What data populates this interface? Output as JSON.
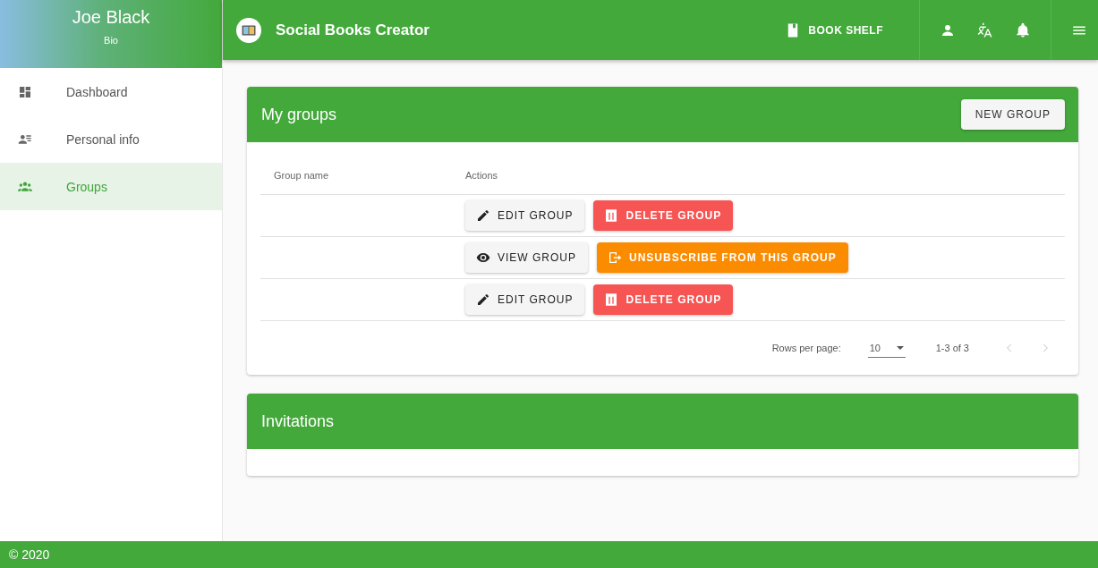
{
  "user": {
    "name": "Joe Black",
    "subtitle": "Bio"
  },
  "sidebar": {
    "items": [
      {
        "label": "Dashboard",
        "kind": "dashboard",
        "selected": false
      },
      {
        "label": "Personal info",
        "kind": "person",
        "selected": false
      },
      {
        "label": "Groups",
        "kind": "groups",
        "selected": true
      }
    ]
  },
  "app_bar": {
    "title": "Social Books Creator",
    "bookshelf": "BOOK SHELF"
  },
  "my_groups": {
    "title": "My groups",
    "new_button": "NEW GROUP",
    "columns": [
      "Group name",
      "Actions"
    ],
    "rows": [
      {
        "actions": [
          {
            "kind": "edit",
            "label": "EDIT GROUP"
          },
          {
            "kind": "delete",
            "label": "DELETE GROUP"
          }
        ]
      },
      {
        "actions": [
          {
            "kind": "view",
            "label": "VIEW GROUP"
          },
          {
            "kind": "unsubscribe",
            "label": "UNSUBSCRIBE FROM THIS GROUP"
          }
        ]
      },
      {
        "actions": [
          {
            "kind": "edit",
            "label": "EDIT GROUP"
          },
          {
            "kind": "delete",
            "label": "DELETE GROUP"
          }
        ]
      }
    ],
    "pagination": {
      "rows_label": "Rows per page:",
      "rows_value": "10",
      "range": "1-3 of 3",
      "prev_disabled": true,
      "next_disabled": true
    }
  },
  "invitations": {
    "title": "Invitations"
  },
  "footer": "© 2020"
}
